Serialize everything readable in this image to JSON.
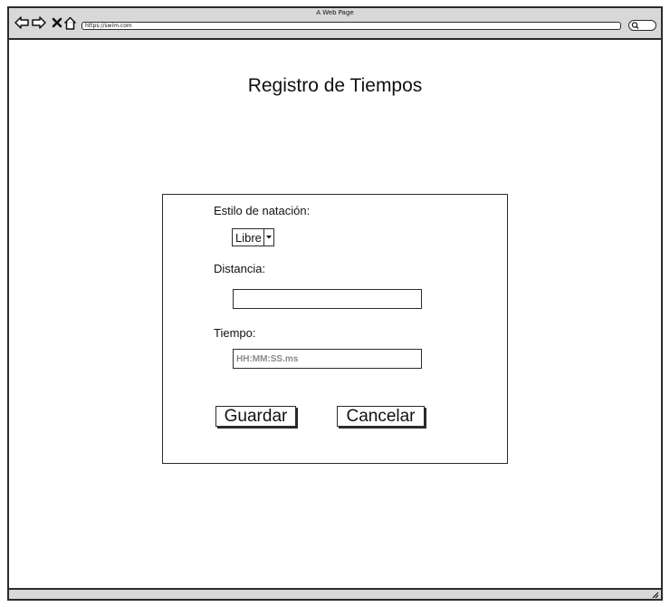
{
  "browser": {
    "title": "A Web Page",
    "url": "https://swim.com"
  },
  "page": {
    "title": "Registro de Tiempos"
  },
  "form": {
    "style_label": "Estilo de natación:",
    "style_value": "Libre",
    "distance_label": "Distancia:",
    "distance_value": "",
    "time_label": "Tiempo:",
    "time_placeholder": "HH:MM:SS.ms",
    "save_label": "Guardar",
    "cancel_label": "Cancelar"
  }
}
